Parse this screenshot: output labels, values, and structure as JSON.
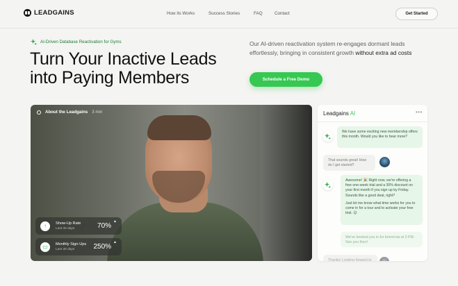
{
  "brand": {
    "name": "LEADGAINS"
  },
  "nav": {
    "links": [
      "How its Works",
      "Success Stories",
      "FAQ",
      "Contact"
    ],
    "cta": "Get Started"
  },
  "hero": {
    "tag": "AI-Driven Database Reactivation for Gyms",
    "headline_line1": "Turn Your Inactive Leads",
    "headline_line2": "into Paying Members",
    "sub_text": "Our AI-driven reactivation system re-engages dormant leads effortlessly, bringing in consistent growth ",
    "sub_emphasis": "without extra ad costs",
    "demo_button": "Schedule a Free Demo"
  },
  "video": {
    "title": "About the Leadgains",
    "duration": "3 min",
    "stats": [
      {
        "label": "Show-Up Rate",
        "sub": "Last 30 days",
        "value": "70%",
        "icon": "trend-up-icon"
      },
      {
        "label": "Monthly Sign-Ups",
        "sub": "Last 30 days",
        "value": "250%",
        "icon": "card-icon"
      }
    ]
  },
  "chat": {
    "title_prefix": "Leadgains",
    "title_suffix": "AI",
    "menu": "•••",
    "messages": [
      {
        "from": "bot",
        "text": "We have some exciting new membership offers this month. Would you like to hear more?"
      },
      {
        "from": "user",
        "text": "That sounds great! How do I get started?"
      },
      {
        "from": "bot",
        "text": "Awesome! 🎉 Right now, we're offering a free one-week trial and a 30% discount on your first month if you sign up by Friday. Sounds like a good deal, right?"
      },
      {
        "from": "bot",
        "text": "Just let me know what time works for you to come in for a tour and to activate your free trial. 😊"
      },
      {
        "from": "bot",
        "text": "We've booked you in for tomorrow at 3 PM. See you then!"
      },
      {
        "from": "user",
        "text": "Thanks! Looking forward to"
      }
    ]
  },
  "colors": {
    "accent": "#36c852",
    "background": "#f4f4f2",
    "bot_bubble": "#e6f6e8"
  }
}
